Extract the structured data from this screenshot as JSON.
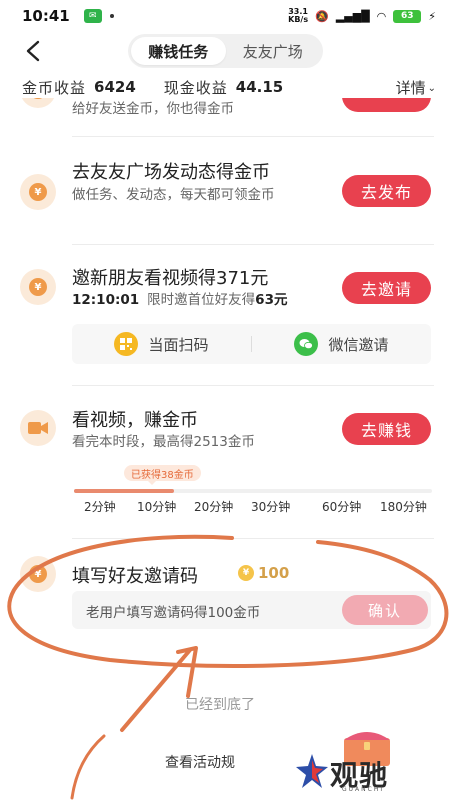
{
  "status_bar": {
    "time": "10:41",
    "net_speed_value": "33.1",
    "net_speed_unit": "KB/s",
    "battery": "63"
  },
  "header": {
    "tabs": [
      {
        "label": "赚钱任务",
        "active": true
      },
      {
        "label": "友友广场",
        "active": false
      }
    ]
  },
  "earnings": {
    "gold_label": "金币收益",
    "gold_value": "6424",
    "cash_label": "现金收益",
    "cash_value": "44.15",
    "detail_label": "详情"
  },
  "tasks": {
    "partial_desc": "给好友送金币，你也得金币",
    "post": {
      "title": "去友友广场发动态得金币",
      "desc": "做任务、发动态，每天都可领金币",
      "button": "去发布"
    },
    "invite": {
      "title": "邀新朋友看视频得371元",
      "timer": "12:10:01",
      "desc_prefix": "限时邀首位好友得",
      "desc_amount": "63元",
      "button": "去邀请",
      "share_scan": "当面扫码",
      "share_wechat": "微信邀请"
    },
    "video": {
      "title": "看视频，赚金币",
      "desc": "看完本时段，最高得2513金币",
      "button": "去赚钱",
      "badge": "已获得38金币",
      "progress_fraction": 0.28,
      "ticks": [
        "2分钟",
        "10分钟",
        "20分钟",
        "30分钟",
        "60分钟",
        "180分钟"
      ]
    },
    "code": {
      "title": "填写好友邀请码",
      "reward": "100",
      "placeholder": "老用户填写邀请码得100金币",
      "button": "确认"
    }
  },
  "footer": {
    "end_text": "已经到底了",
    "rules_link": "查看活动规"
  },
  "watermark": {
    "logo": "观驰",
    "sub": "GUANCHI"
  },
  "colors": {
    "accent_red": "#e8414f",
    "confirm_disabled": "#f2aab2",
    "coin_orange": "#ef9a4a",
    "annotation": "#e0784a"
  }
}
